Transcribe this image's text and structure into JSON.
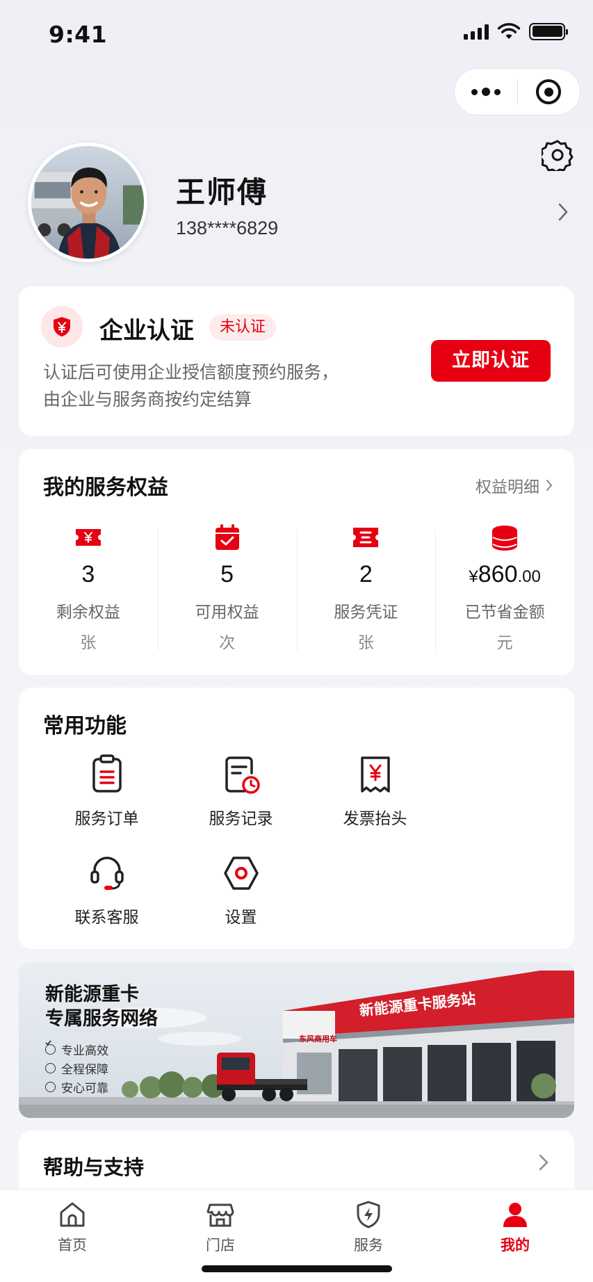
{
  "status_bar": {
    "time": "9:41"
  },
  "profile": {
    "name": "王师傅",
    "phone": "138****6829"
  },
  "enterprise": {
    "title": "企业认证",
    "tag": "未认证",
    "desc_line1": "认证后可使用企业授信额度预约服务，",
    "desc_line2": "由企业与服务商按约定结算",
    "button": "立即认证"
  },
  "rights": {
    "title": "我的服务权益",
    "link": "权益明细",
    "items": [
      {
        "icon": "coupon-yen-icon",
        "value": "3",
        "label": "剩余权益",
        "unit": "张"
      },
      {
        "icon": "calendar-check-icon",
        "value": "5",
        "label": "可用权益",
        "unit": "次"
      },
      {
        "icon": "ticket-icon",
        "value": "2",
        "label": "服务凭证",
        "unit": "张"
      },
      {
        "icon": "coin-stack-icon",
        "currency": "¥",
        "value": "860",
        "decimal": ".00",
        "label": "已节省金额",
        "unit": "元"
      }
    ]
  },
  "functions": {
    "title": "常用功能",
    "items": [
      {
        "icon": "clipboard-icon",
        "label": "服务订单"
      },
      {
        "icon": "document-clock-icon",
        "label": "服务记录"
      },
      {
        "icon": "receipt-icon",
        "label": "发票抬头"
      },
      {
        "icon": "headset-icon",
        "label": "联系客服"
      },
      {
        "icon": "hex-settings-icon",
        "label": "设置"
      }
    ]
  },
  "banner": {
    "title_line1": "新能源重卡",
    "title_line2": "专属服务网络",
    "points": [
      "专业高效",
      "全程保障",
      "安心可靠"
    ],
    "sign": "新能源重卡服务站",
    "brand": "东风商用车"
  },
  "help": {
    "title": "帮助与支持"
  },
  "tabbar": {
    "tabs": [
      {
        "icon": "home-icon",
        "label": "首页",
        "active": false
      },
      {
        "icon": "store-icon",
        "label": "门店",
        "active": false
      },
      {
        "icon": "service-bolt-icon",
        "label": "服务",
        "active": false
      },
      {
        "icon": "user-icon",
        "label": "我的",
        "active": true
      }
    ]
  },
  "colors": {
    "accent": "#e60012",
    "background": "#f2f3f7",
    "card": "#ffffff"
  }
}
